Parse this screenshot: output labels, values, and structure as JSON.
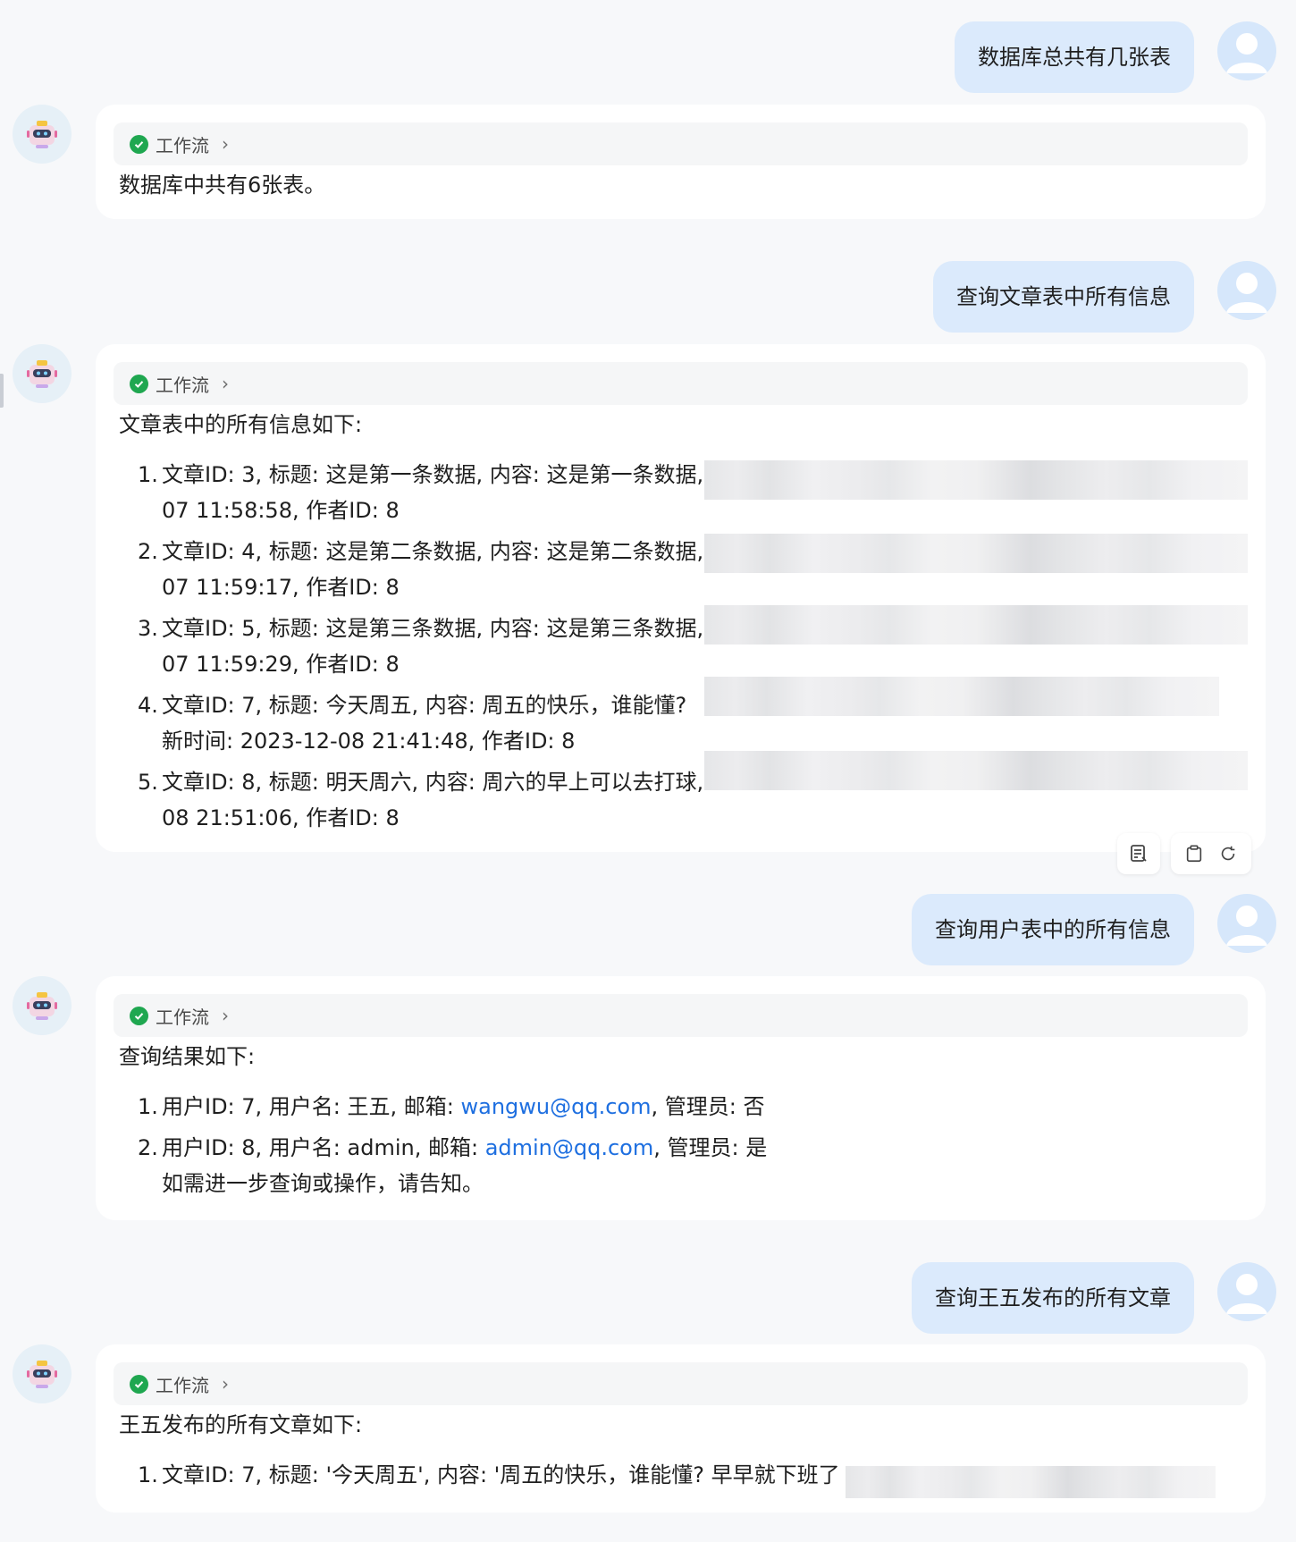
{
  "workflow_label": "工作流",
  "messages": {
    "q1": "数据库总共有几张表",
    "a1": "数据库中共有6张表。",
    "q2": "查询文章表中所有信息",
    "a2_intro": "文章表中的所有信息如下:",
    "a2_items": [
      {
        "num": "1.",
        "line1": "文章ID: 3, 标题: 这是第一条数据, 内容: 这是第一条数据,",
        "line2": "07 11:58:58, 作者ID: 8"
      },
      {
        "num": "2.",
        "line1": "文章ID: 4, 标题: 这是第二条数据, 内容: 这是第二条数据,",
        "line2": "07 11:59:17, 作者ID: 8"
      },
      {
        "num": "3.",
        "line1": "文章ID: 5, 标题: 这是第三条数据, 内容: 这是第三条数据,",
        "line2": "07 11:59:29, 作者ID: 8"
      },
      {
        "num": "4.",
        "line1": "文章ID: 7, 标题: 今天周五, 内容: 周五的快乐，谁能懂?",
        "line2": "新时间: 2023-12-08 21:41:48, 作者ID: 8"
      },
      {
        "num": "5.",
        "line1": "文章ID: 8, 标题: 明天周六, 内容: 周六的早上可以去打球,",
        "line2": "08 21:51:06, 作者ID: 8"
      }
    ],
    "q3": "查询用户表中的所有信息",
    "a3_intro": "查询结果如下:",
    "a3_items": [
      {
        "num": "1.",
        "pre": "用户ID: 7, 用户名: 王五, 邮箱: ",
        "email": "wangwu@qq.com",
        "post": ", 管理员: 否"
      },
      {
        "num": "2.",
        "pre": "用户ID: 8, 用户名: admin, 邮箱: ",
        "email": "admin@qq.com",
        "post": ", 管理员: 是"
      }
    ],
    "a3_footer": "如需进一步查询或操作，请告知。",
    "q4": "查询王五发布的所有文章",
    "a4_intro": "王五发布的所有文章如下:",
    "a4_items": [
      {
        "num": "1.",
        "line1": "文章ID: 7, 标题: '今天周五', 内容: '周五的快乐，谁能懂? 早早就下班了"
      }
    ]
  },
  "icons": {
    "user_avatar": "user-avatar-icon",
    "bot_avatar": "robot-avatar-icon",
    "check": "check-circle-icon",
    "chevron": "chevron-right-icon",
    "note": "note-icon",
    "copy": "clipboard-icon",
    "refresh": "refresh-icon"
  },
  "colors": {
    "user_bubble": "#dbeafc",
    "link": "#1e6fe0",
    "success": "#1fa750"
  }
}
